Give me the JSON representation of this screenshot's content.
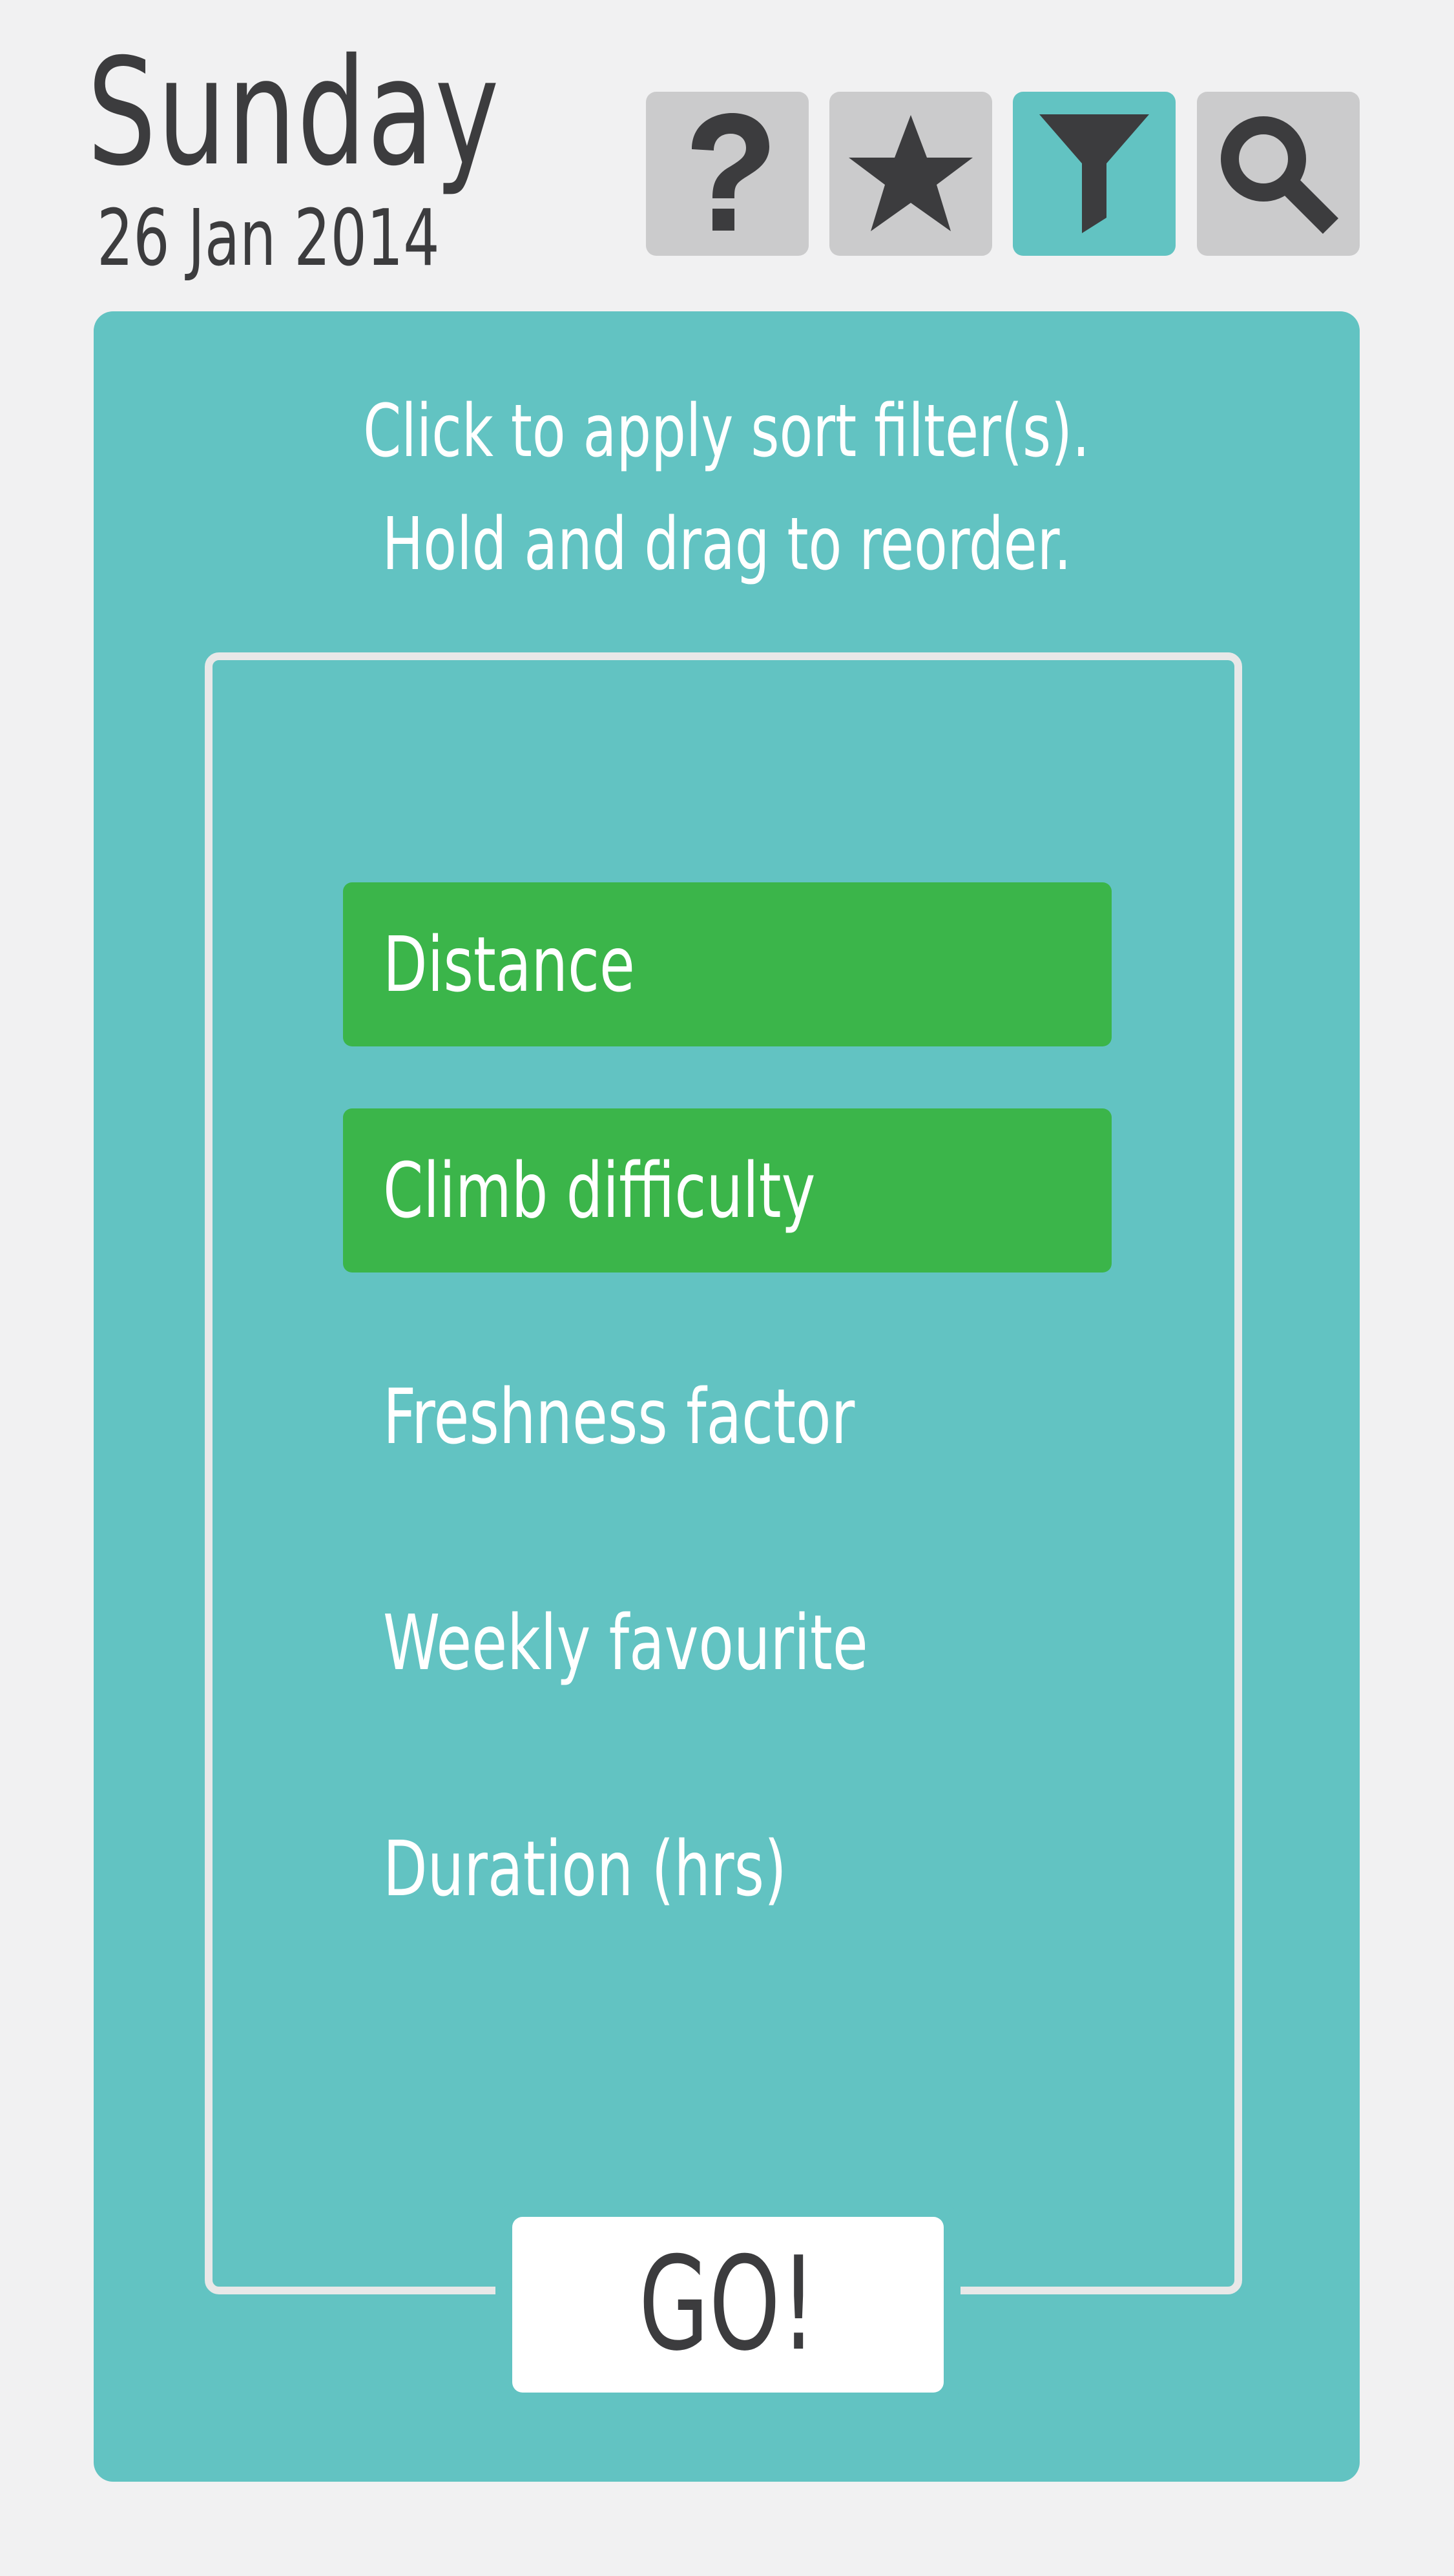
{
  "header": {
    "day": "Sunday",
    "date": "26 Jan 2014"
  },
  "toolbar": {
    "buttons": [
      {
        "icon": "question-mark-icon",
        "active": false
      },
      {
        "icon": "star-icon",
        "active": false
      },
      {
        "icon": "filter-funnel-icon",
        "active": true
      },
      {
        "icon": "search-magnifier-icon",
        "active": false
      }
    ]
  },
  "panel": {
    "instruction_line_1": "Click to apply sort filter(s).",
    "instruction_line_2": "Hold and drag to reorder.",
    "filters": [
      {
        "label": "Distance",
        "selected": true
      },
      {
        "label": "Climb difficulty",
        "selected": true
      },
      {
        "label": "Freshness factor",
        "selected": false
      },
      {
        "label": "Weekly favourite",
        "selected": false
      },
      {
        "label": "Duration (hrs)",
        "selected": false
      }
    ],
    "go_label": "GO!"
  },
  "colors": {
    "background": "#f1f1f2",
    "panel_teal": "#62c3c2",
    "selected_green": "#3bb54a",
    "button_grey": "#cbcbcc",
    "icon_dark": "#3c3c3e",
    "text_white": "#ffffff"
  }
}
